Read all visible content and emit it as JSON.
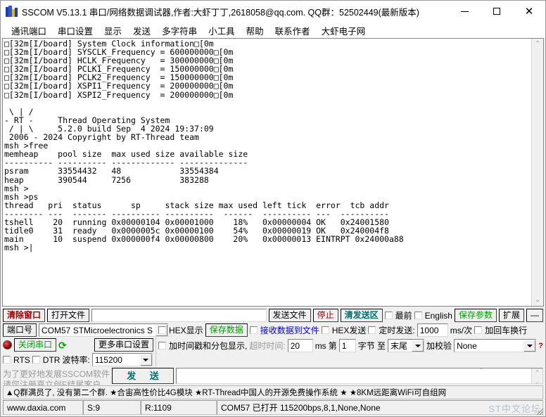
{
  "window": {
    "title": "SSCOM V5.13.1 串口/网络数据调试器,作者:大虾丁丁,2618058@qq.com. QQ群：52502449(最新版本)",
    "icon": "app-icon",
    "minimize": "–",
    "maximize": "□",
    "close": "✕"
  },
  "menubar": {
    "items": [
      {
        "label": "通讯端口"
      },
      {
        "label": "串口设置"
      },
      {
        "label": "显示"
      },
      {
        "label": "发送"
      },
      {
        "label": "多字符串"
      },
      {
        "label": "小工具"
      },
      {
        "label": "帮助"
      },
      {
        "label": "联系作者"
      },
      {
        "label": "大虾电子网"
      }
    ]
  },
  "terminal": {
    "content": "□[32m[I/board] System Clock information□[0m\n□[32m[I/board] SYSCLK_Frequency = 600000000□[0m\n□[32m[I/board] HCLK_Frequency   = 300000000□[0m\n□[32m[I/board] PCLK1_Frequency  = 150000000□[0m\n□[32m[I/board] PCLK2_Frequency  = 150000000□[0m\n□[32m[I/board] XSPI1_Frequency  = 200000000□[0m\n□[32m[I/board] XSPI2_Frequency  = 200000000□[0m\n\n \\ | /\n- RT -     Thread Operating System\n / | \\     5.2.0 build Sep  4 2024 19:37:09\n 2006 - 2024 Copyright by RT-Thread team\nmsh >free\nmemheap    pool size  max used size available size\n---------- ---------- ------------- --------------\npsram      33554432   48            33554384\nheap       390544     7256          383288\nmsh >\nmsh >ps\nthread   pri  status      sp     stack size max used left tick  error  tcb addr\n-------- ---  ------- ---------- ----------  ------  ---------- ---  ----------\ntshell    20  running 0x00000104 0x00001000    18%   0x00000004 OK   0x24001580\ntidle0    31  ready   0x0000005c 0x00000100    54%   0x00000019 OK   0x240004f8\nmain      10  suspend 0x000000f4 0x00000800    20%   0x00000013 EINTRPT 0x24000a88\nmsh >|",
    "scroll_up": "⌃",
    "scroll_down": "⌄"
  },
  "toolbar_row1": {
    "clear_window": "清除窗口",
    "open_file": "打开文件",
    "file_path": "",
    "send_file": "发送文件",
    "stop": "停止",
    "clear_send": "清发送区",
    "topmost_label": "最前",
    "english_label": "English",
    "save_params": "保存参数",
    "extend": "扩展",
    "collapse": "—"
  },
  "serial": {
    "port_label": "端口号",
    "port_value": "COM57 STMicroelectronics S",
    "close_port_button": "关闭串口",
    "refresh_icon": "refresh-icon",
    "more_settings": "更多串口设置",
    "rts_label": "RTS",
    "dtr_label": "DTR",
    "baud_label": "波特率:",
    "baud_value": "115200"
  },
  "options": {
    "hex_display": "HEX显示",
    "save_data": "保存数据",
    "recv_to_file": "接收数据到文件",
    "hex_send": "HEX发送",
    "timed_send": "定时发送:",
    "timed_value": "1000",
    "timed_unit": "ms/次",
    "add_crlf": "加回车换行",
    "timestamp_pack": "加时间戳和分包显示,",
    "timeout_label": "超时时间:",
    "timeout_value": "20",
    "timeout_unit": "ms",
    "byte_prefix": "第",
    "byte_index": "1",
    "byte_mid": "字节 至",
    "byte_end": "末尾",
    "checksum_label": "加校验",
    "checksum_value": "None",
    "help_marker": "?"
  },
  "promo": {
    "line1": "为了更好地发展SSCOM软件",
    "line2": "请您注册嘉立创F结尾客户",
    "send_button": "发 送"
  },
  "watermark": {
    "label": "ST中文论坛",
    "icon": "chat-bubble-icon"
  },
  "adbar": {
    "text": "▲Q群满员了, 没有第二个群.  ★合宙高性价比4G模块  ★RT-Thread中国人的开源免费操作系统  ★   ★8KM远距离WiFi可自组网"
  },
  "statusbar": {
    "site": "www.daxia.com",
    "sent": "S:9",
    "received": "R:1109",
    "connection": "COM57 已打开  115200bps,8,1,None,None"
  },
  "colors": {
    "accent_red": "#9c0006",
    "accent_teal": "#006e6e",
    "accent_green": "#00a000",
    "accent_blue": "#0000d0",
    "window_bg": "#f0f0f0"
  }
}
